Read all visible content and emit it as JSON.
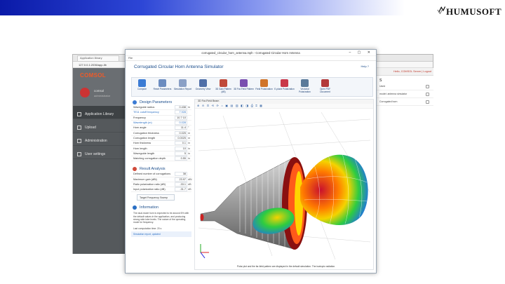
{
  "slide": {
    "logo_text": "HUMUSOFT"
  },
  "backwin": {
    "tab": "Application library",
    "url": "127.0.0.1:2036/app-lib",
    "brand": "COMSOL",
    "user_name": "comsol",
    "user_role": "administrator",
    "nav": [
      {
        "label": "Application Library"
      },
      {
        "label": "Upload"
      },
      {
        "label": "Administration"
      },
      {
        "label": "User settings"
      }
    ],
    "right": {
      "header": "Hello, COMSOL Server  |  Logout",
      "title": "s",
      "rows": [
        "Used",
        "model: antenna simulator",
        "Corrugated horn"
      ]
    }
  },
  "win": {
    "title": "corrugated_circular_horn_antenna.mph - Corrugated Circular Horn Antenna",
    "menu": "File",
    "app_title": "Corrugated Circular Horn Antenna Simulator",
    "help": "Help  ?",
    "ribbon": [
      {
        "label": "Compute",
        "color": "#3b7bd4"
      },
      {
        "label": "Reset Parameters",
        "color": "#6b8cc0"
      },
      {
        "label": "Simulation Report",
        "color": "#8aa0c6"
      },
      {
        "label": "Geometry View",
        "color": "#4f6fa8"
      },
      {
        "label": "3D Gain Pattern (dB)",
        "color": "#c04a3a"
      },
      {
        "label": "3D Far-Field Pattern",
        "color": "#7a4fb0"
      },
      {
        "label": "Field Polarization",
        "color": "#d0742a"
      },
      {
        "label": "E-plane Polarization",
        "color": "#c9394a"
      },
      {
        "label": "Vectorial Polarization",
        "color": "#5a7a9a"
      },
      {
        "label": "Open PDF Document",
        "color": "#b33a3a"
      }
    ],
    "design_params": {
      "heading": "Design Parameters",
      "rows": [
        {
          "label": "Waveguide radius",
          "value": "0.438",
          "unit": "in"
        },
        {
          "label": "TE11 cutoff frequency",
          "value": "7.928",
          "unit": ""
        },
        {
          "label": "Frequency",
          "value": "10.7·10",
          "unit": ""
        },
        {
          "label": "Wavelength (m)",
          "value": "0.028",
          "unit": ""
        },
        {
          "label": "Horn angle",
          "value": "11.4",
          "unit": "°"
        },
        {
          "label": "Corrugation thickness",
          "value": "0.025",
          "unit": "m"
        },
        {
          "label": "Corrugation length",
          "value": "0.0025",
          "unit": "m"
        },
        {
          "label": "Horn thickness",
          "value": "0.1",
          "unit": "in"
        },
        {
          "label": "Horn length",
          "value": "10",
          "unit": "in"
        },
        {
          "label": "Waveguide length",
          "value": "5",
          "unit": "in"
        },
        {
          "label": "Matching corrugation depth",
          "value": "0.55",
          "unit": "in"
        }
      ]
    },
    "results": {
      "heading": "Result Analysis",
      "rows": [
        {
          "label": "Defined number of corrugations",
          "value": "38",
          "unit": ""
        },
        {
          "label": "Maximum gain (dBi)",
          "value": "23.97",
          "unit": "dBi"
        },
        {
          "label": "Ratio polarization ratio (dB)",
          "value": "-33.1",
          "unit": "dB"
        },
        {
          "label": "Input polarization ratio (dB)",
          "value": "-31.7",
          "unit": "dB"
        }
      ],
      "button": "Target Frequency Sweep"
    },
    "information": {
      "heading": "Information",
      "text": "The dual-mode horn is expected to be around 6% with the default values in the application, and producing strong side-lobe levels. The nature of the operating mode for frequency.",
      "last_compute": "Last computation time: 20 s",
      "link": "Simulation report, updated"
    },
    "graphics": {
      "tab": "3D Far-Field Beam",
      "toolbar": "⊕ ⊖ ⊡ ⟲ ⟳ ⌂ ▣ ▤ ▥ ◧ ◨ ⎙ ⌗ ▦",
      "footer": "Polar plot and the far-field pattern are displayed in the default simulation. The isotropic radiation."
    }
  }
}
